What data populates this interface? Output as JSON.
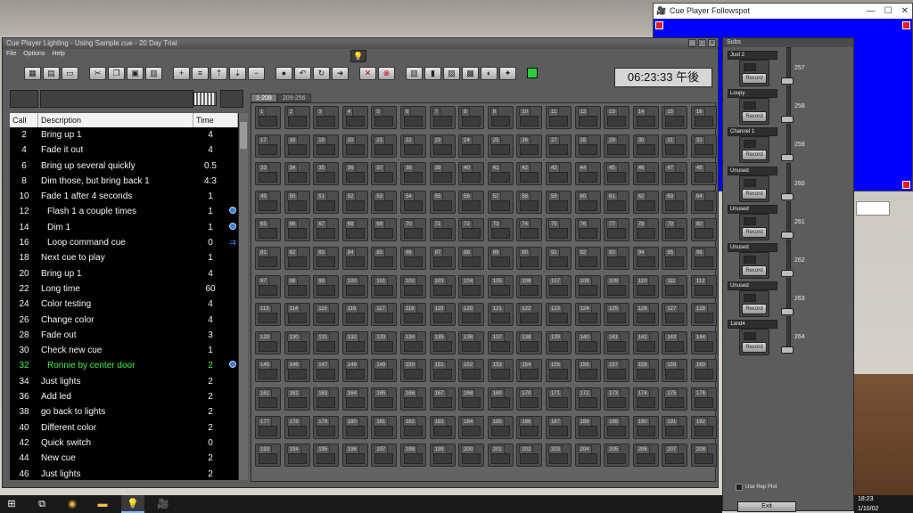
{
  "main_window": {
    "title": "Cue Player Lighting - Using Sample.cue - 20 Day Trial",
    "menu": [
      "File",
      "Options",
      "Help"
    ],
    "clock": "06:23:33 午後"
  },
  "cue_list": {
    "columns": [
      "Call",
      "Description",
      "Time"
    ],
    "rows": [
      {
        "call": "2",
        "desc": "Bring up 1",
        "time": "4",
        "indent": false,
        "icon": ""
      },
      {
        "call": "4",
        "desc": "Fade it out",
        "time": "4",
        "indent": false,
        "icon": ""
      },
      {
        "call": "6",
        "desc": "Bring up several quickly",
        "time": "0.5",
        "indent": false,
        "icon": ""
      },
      {
        "call": "8",
        "desc": "Dim those, but bring back 1",
        "time": "4:3",
        "indent": false,
        "icon": ""
      },
      {
        "call": "10",
        "desc": "Fade 1 after 4 seconds",
        "time": "1",
        "indent": false,
        "icon": ""
      },
      {
        "call": "12",
        "desc": "Flash 1 a couple times",
        "time": "1",
        "indent": true,
        "icon": "blue"
      },
      {
        "call": "14",
        "desc": "Dim 1",
        "time": "1",
        "indent": true,
        "icon": "blue"
      },
      {
        "call": "16",
        "desc": "Loop command cue",
        "time": "0",
        "indent": true,
        "icon": "loop"
      },
      {
        "call": "18",
        "desc": "Next cue to play",
        "time": "1",
        "indent": false,
        "icon": ""
      },
      {
        "call": "20",
        "desc": "Bring up 1",
        "time": "4",
        "indent": false,
        "icon": ""
      },
      {
        "call": "22",
        "desc": "Long time",
        "time": "60",
        "indent": false,
        "icon": ""
      },
      {
        "call": "24",
        "desc": "Color testing",
        "time": "4",
        "indent": false,
        "icon": ""
      },
      {
        "call": "26",
        "desc": "Change color",
        "time": "4",
        "indent": false,
        "icon": ""
      },
      {
        "call": "28",
        "desc": "Fade out",
        "time": "3",
        "indent": false,
        "icon": ""
      },
      {
        "call": "30",
        "desc": "Check new cue",
        "time": "1",
        "indent": false,
        "icon": ""
      },
      {
        "call": "32",
        "desc": "Ronnie by center door",
        "time": "2",
        "indent": true,
        "icon": "blue",
        "highlight": true
      },
      {
        "call": "34",
        "desc": "Just lights",
        "time": "2",
        "indent": false,
        "icon": ""
      },
      {
        "call": "36",
        "desc": "Add led",
        "time": "2",
        "indent": false,
        "icon": ""
      },
      {
        "call": "38",
        "desc": "go back to lights",
        "time": "2",
        "indent": false,
        "icon": ""
      },
      {
        "call": "40",
        "desc": "Different color",
        "time": "2",
        "indent": false,
        "icon": ""
      },
      {
        "call": "42",
        "desc": "Quick switch",
        "time": "0",
        "indent": false,
        "icon": ""
      },
      {
        "call": "44",
        "desc": "New cue",
        "time": "2",
        "indent": false,
        "icon": ""
      },
      {
        "call": "46",
        "desc": "Just lights",
        "time": "2",
        "indent": false,
        "icon": ""
      }
    ]
  },
  "channel_grid": {
    "tabs": [
      "1-208",
      "209-256"
    ],
    "active_tab": 0,
    "count": 208
  },
  "followspot": {
    "title": "Cue Player Followspot"
  },
  "subs": {
    "title": "Subs",
    "items": [
      {
        "label": "Just 2",
        "num": "257"
      },
      {
        "label": "Loopy",
        "num": "258"
      },
      {
        "label": "Channel 1",
        "num": "259"
      },
      {
        "label": "Unused",
        "num": "260"
      },
      {
        "label": "Unused",
        "num": "261"
      },
      {
        "label": "Unused",
        "num": "262"
      },
      {
        "label": "Unused",
        "num": "263"
      },
      {
        "label": "1and4",
        "num": "264"
      }
    ],
    "record_label": "Record",
    "rep_plot": "Use Rep Plot",
    "exit": "Exit"
  },
  "taskbar": {
    "time": "18:23",
    "date": "1/10/02"
  },
  "colors": {
    "highlight_text": "#3ef53e",
    "accent_blue": "#3d7de0",
    "status_led": "#2dcc3a"
  }
}
